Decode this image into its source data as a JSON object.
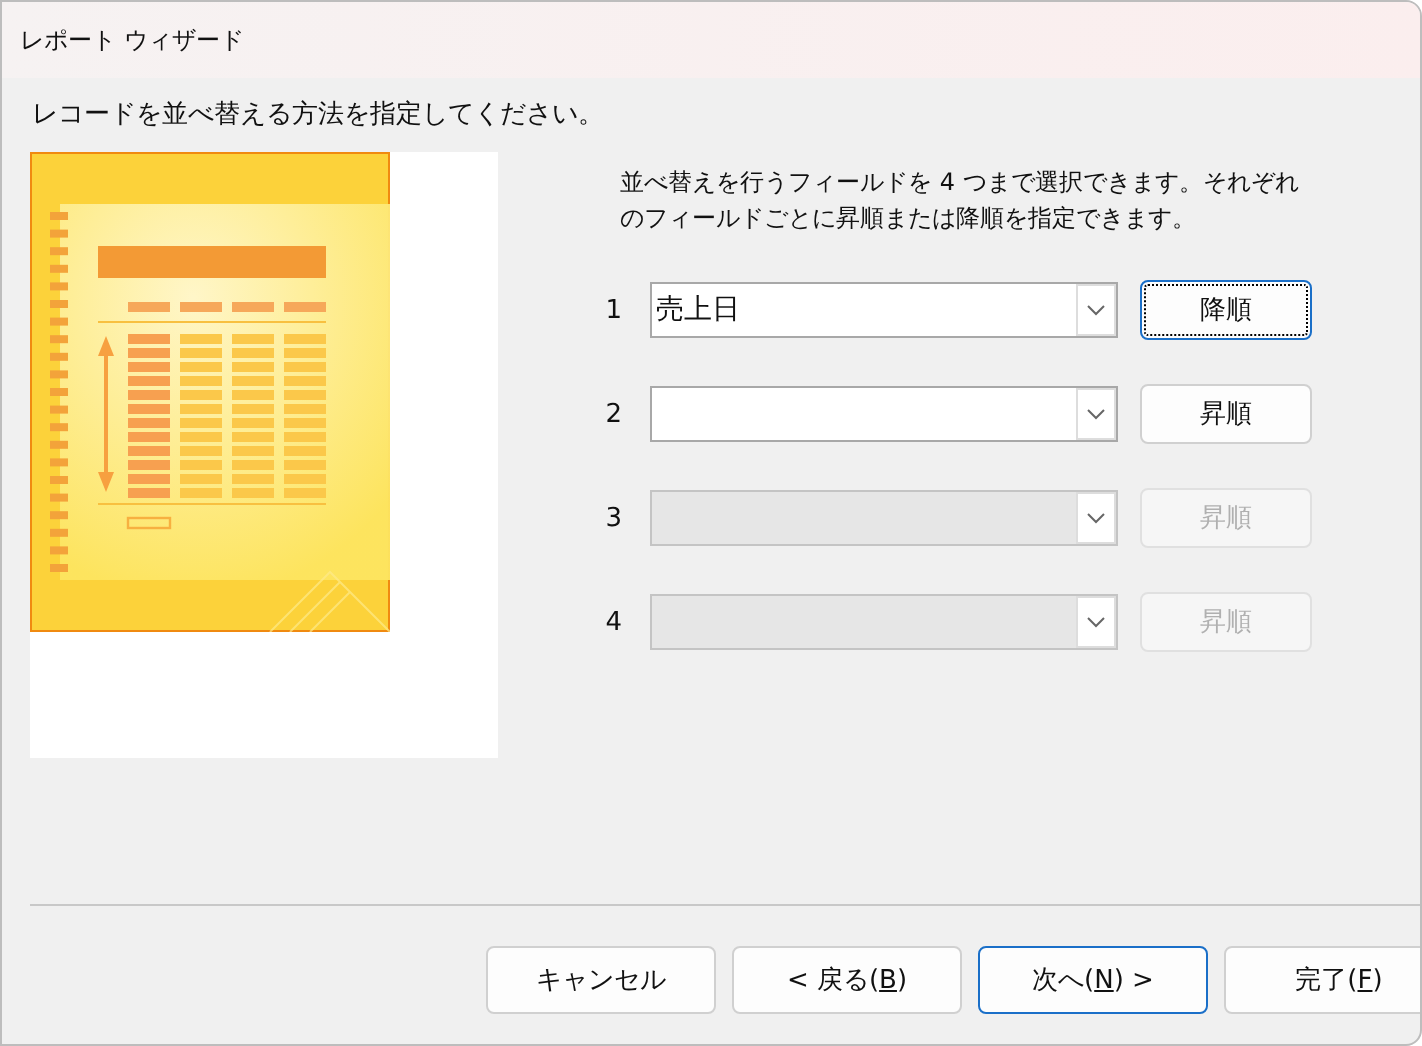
{
  "window": {
    "title": "レポート ウィザード"
  },
  "instruction": "レコードを並べ替える方法を指定してください。",
  "description": "並べ替えを行うフィールドを 4 つまで選択できます。それぞれのフィールドごとに昇順または降順を指定できます。",
  "sort_fields": [
    {
      "number": "1",
      "value": "売上日",
      "disabled": false,
      "order_button": "降順",
      "focused": true
    },
    {
      "number": "2",
      "disabled": false,
      "order_button": "昇順",
      "focused": false
    },
    {
      "number": "3",
      "disabled": true,
      "order_button": "昇順",
      "focused": false
    },
    {
      "number": "4",
      "disabled": true,
      "order_button": "昇順",
      "focused": false
    }
  ],
  "buttons": [
    {
      "parts": [
        "キャンセル"
      ],
      "default": false
    },
    {
      "parts": [
        "< 戻る(",
        "B",
        ")"
      ],
      "default": false
    },
    {
      "parts": [
        "次へ(",
        "N",
        ") >"
      ],
      "default": true
    },
    {
      "parts": [
        "完了(",
        "F",
        ")"
      ],
      "default": false
    }
  ]
}
